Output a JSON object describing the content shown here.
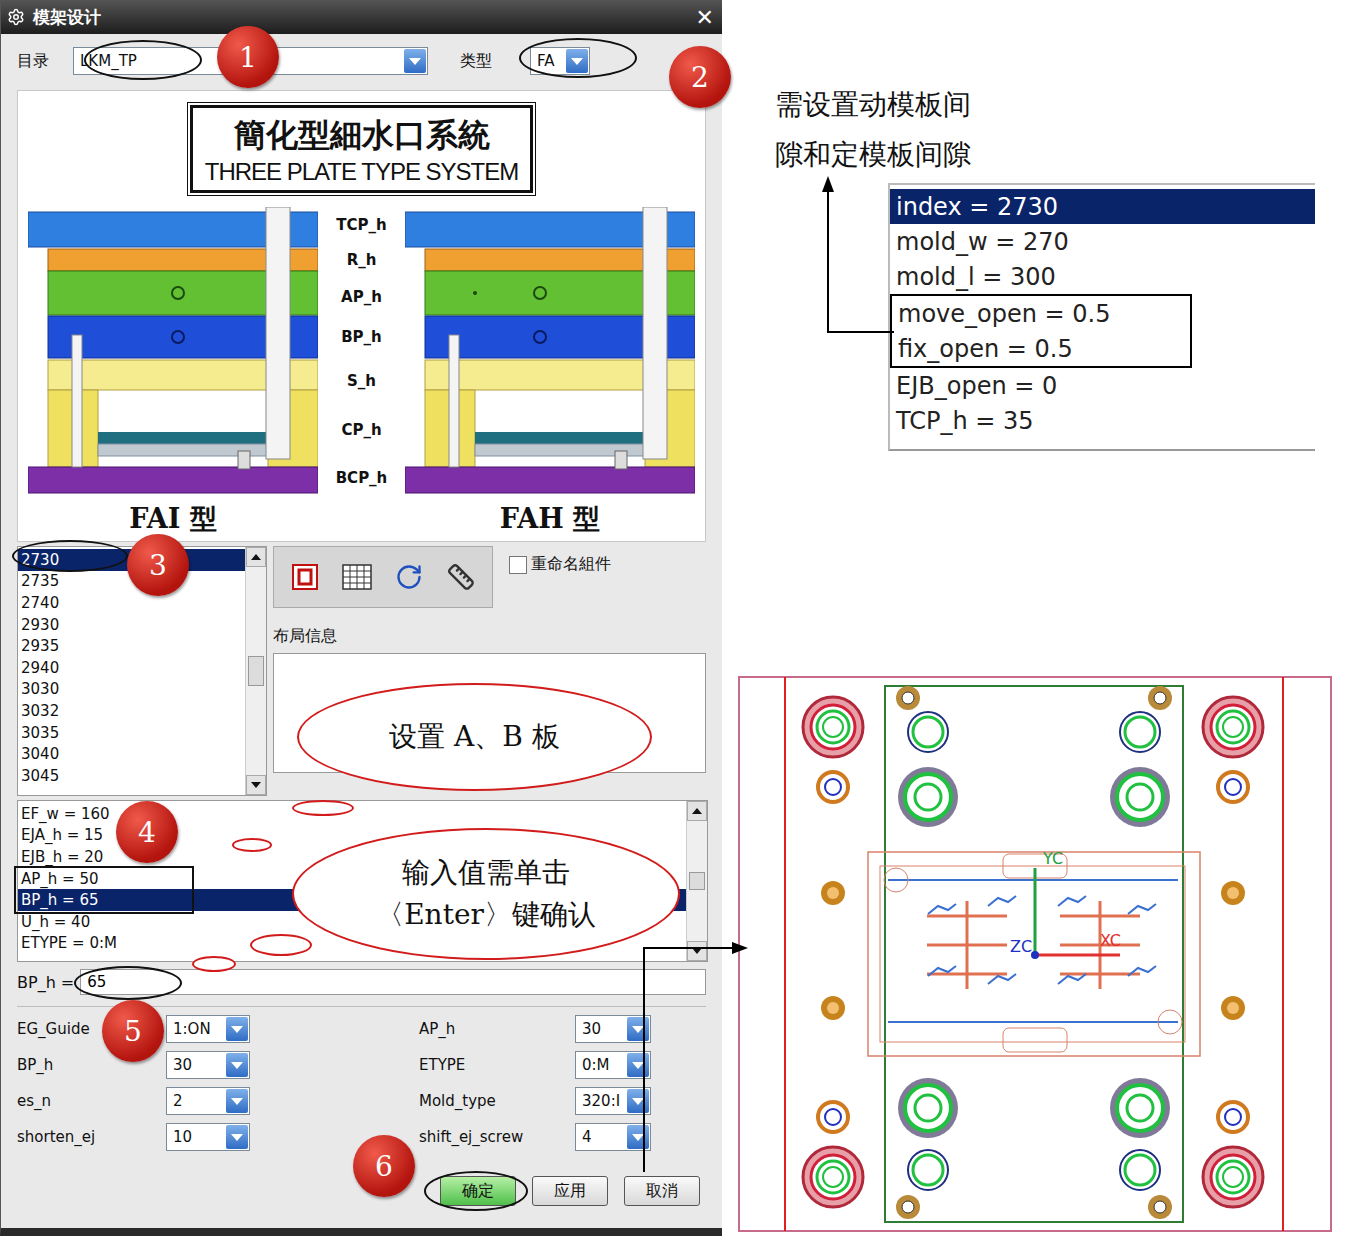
{
  "window": {
    "title": "模架设计",
    "close": "✕"
  },
  "catalog": {
    "label": "目录",
    "value": "LKM_TP"
  },
  "type": {
    "label": "类型",
    "value": "FA"
  },
  "preview": {
    "title_cn": "簡化型細水口系統",
    "title_en": "THREE PLATE TYPE SYSTEM",
    "plate_labels": [
      "TCP_h",
      "R_h",
      "AP_h",
      "BP_h",
      "S_h",
      "CP_h",
      "BCP_h"
    ],
    "captions": [
      "FAI 型",
      "FAH 型"
    ]
  },
  "sizes": [
    {
      "label": "2730",
      "selected": true
    },
    {
      "label": "2735",
      "selected": false
    },
    {
      "label": "2740",
      "selected": false
    },
    {
      "label": "2930",
      "selected": false
    },
    {
      "label": "2935",
      "selected": false
    },
    {
      "label": "2940",
      "selected": false
    },
    {
      "label": "3030",
      "selected": false
    },
    {
      "label": "3032",
      "selected": false
    },
    {
      "label": "3035",
      "selected": false
    },
    {
      "label": "3040",
      "selected": false
    },
    {
      "label": "3045",
      "selected": false
    }
  ],
  "rename": {
    "label": "重命名組件",
    "checked": false
  },
  "layout_info": {
    "label": "布局信息"
  },
  "params": [
    {
      "label": "EF_w = 160",
      "selected": false
    },
    {
      "label": "EJA_h = 15",
      "selected": false
    },
    {
      "label": "EJB_h = 20",
      "selected": false
    },
    {
      "label": "AP_h = 50",
      "selected": false
    },
    {
      "label": "BP_h = 65",
      "selected": true
    },
    {
      "label": "U_h = 40",
      "selected": false
    },
    {
      "label": "ETYPE = 0:M",
      "selected": false
    }
  ],
  "edit": {
    "label": "BP_h =",
    "value": "65"
  },
  "options": [
    {
      "label": "EG_Guide",
      "value": "1:ON"
    },
    {
      "label": "AP_h",
      "value": "30"
    },
    {
      "label": "BP_h",
      "value": "30"
    },
    {
      "label": "ETYPE",
      "value": "0:M"
    },
    {
      "label": "es_n",
      "value": "2"
    },
    {
      "label": "Mold_type",
      "value": "320:I"
    },
    {
      "label": "shorten_ej",
      "value": "10"
    },
    {
      "label": "shift_ej_screw",
      "value": "4"
    }
  ],
  "buttons": [
    {
      "label": "确定",
      "primary": true
    },
    {
      "label": "应用",
      "primary": false
    },
    {
      "label": "取消",
      "primary": false
    }
  ],
  "badges": [
    "1",
    "2",
    "3",
    "4",
    "5",
    "6"
  ],
  "clouds": [
    "设置 A、B 板",
    "输入值需单击〈Enter〉键确认"
  ],
  "note": "需设置动模板间隙和定模板间隙",
  "zoom_list": [
    {
      "label": "index = 2730",
      "selected": true,
      "boxed": false
    },
    {
      "label": "mold_w = 270",
      "selected": false,
      "boxed": false
    },
    {
      "label": "mold_l = 300",
      "selected": false,
      "boxed": false
    },
    {
      "label": "move_open = 0.5",
      "selected": false,
      "boxed": true
    },
    {
      "label": "fix_open = 0.5",
      "selected": false,
      "boxed": true
    },
    {
      "label": "EJB_open = 0",
      "selected": false,
      "boxed": false
    },
    {
      "label": "TCP_h = 35",
      "selected": false,
      "boxed": false
    }
  ],
  "cad_axes": [
    "YC",
    "ZC",
    "XC"
  ]
}
